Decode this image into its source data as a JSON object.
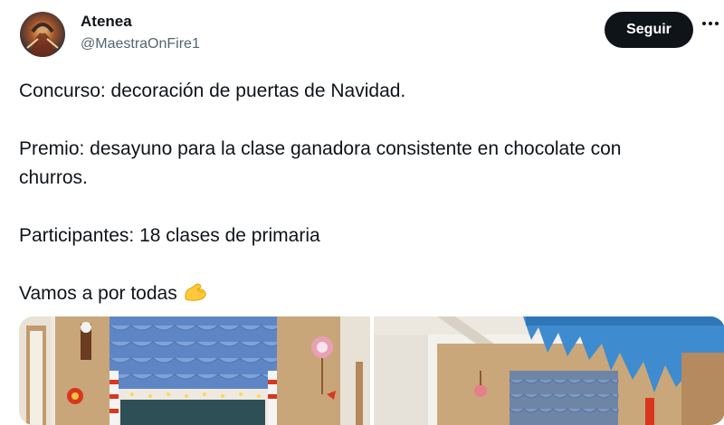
{
  "author": {
    "name": "Atenea",
    "handle": "@MaestraOnFire1",
    "avatar_icon": "avatar-photo"
  },
  "follow_button": {
    "label": "Seguir"
  },
  "more_icon": "more-horizontal-icon",
  "tweet": {
    "line1": "Concurso: decoración de puertas de Navidad.",
    "line2a": "Premio: desayuno para la clase ganadora consistente en chocolate con",
    "line2b": "churros.",
    "line3": "Participantes: 18 clases de primaria",
    "line4": "Vamos a por todas",
    "emoji": "flexed-biceps-icon"
  },
  "media": {
    "count": 2,
    "photo_1": "christmas-door-decoration-photo",
    "photo_2": "icicle-door-decoration-photo"
  },
  "colors": {
    "button_bg": "#0f1419",
    "text": "#0f1419",
    "secondary": "#536471"
  }
}
